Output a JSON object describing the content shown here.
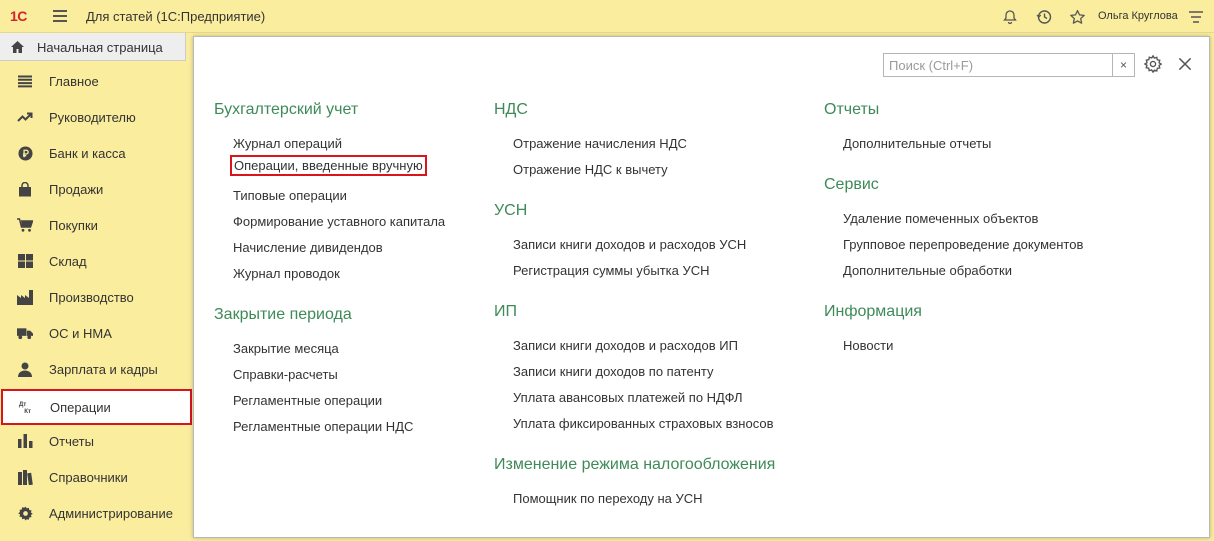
{
  "titlebar": {
    "logo": "1С",
    "title": "Для статей  (1С:Предприятие)",
    "user": "Ольга Круглова",
    "icons": [
      "bell-icon",
      "history-icon",
      "star-icon",
      "menu-lines-icon"
    ]
  },
  "home_tab": {
    "label": "Начальная страница",
    "icon": "home-icon"
  },
  "sidebar": {
    "items": [
      {
        "label": "Главное",
        "icon": "list-icon"
      },
      {
        "label": "Руководителю",
        "icon": "trend-icon"
      },
      {
        "label": "Банк и касса",
        "icon": "ruble-icon"
      },
      {
        "label": "Продажи",
        "icon": "bag-icon"
      },
      {
        "label": "Покупки",
        "icon": "cart-icon"
      },
      {
        "label": "Склад",
        "icon": "grid-icon"
      },
      {
        "label": "Производство",
        "icon": "factory-icon"
      },
      {
        "label": "ОС и НМА",
        "icon": "truck-icon"
      },
      {
        "label": "Зарплата и кадры",
        "icon": "person-icon"
      },
      {
        "label": "Операции",
        "icon": "dt-kt-icon",
        "active": true
      },
      {
        "label": "Отчеты",
        "icon": "bar-chart-icon"
      },
      {
        "label": "Справочники",
        "icon": "books-icon"
      },
      {
        "label": "Администрирование",
        "icon": "gear-icon"
      }
    ]
  },
  "panel": {
    "search_placeholder": "Поиск (Ctrl+F)",
    "search_clear": "×",
    "sections": {
      "accounting": {
        "title": "Бухгалтерский учет",
        "links": [
          "Журнал операций",
          "Операции, введенные вручную",
          "Типовые операции",
          "Формирование уставного капитала",
          "Начисление дивидендов",
          "Журнал проводок"
        ]
      },
      "closing": {
        "title": "Закрытие периода",
        "links": [
          "Закрытие месяца",
          "Справки-расчеты",
          "Регламентные операции",
          "Регламентные операции НДС"
        ]
      },
      "vat": {
        "title": "НДС",
        "links": [
          "Отражение начисления НДС",
          "Отражение НДС к вычету"
        ]
      },
      "usn": {
        "title": "УСН",
        "links": [
          "Записи книги доходов и расходов УСН",
          "Регистрация суммы убытка УСН"
        ]
      },
      "ip": {
        "title": "ИП",
        "links": [
          "Записи книги доходов и расходов ИП",
          "Записи книги доходов по патенту",
          "Уплата авансовых платежей по НДФЛ",
          "Уплата фиксированных страховых взносов"
        ]
      },
      "tax_change": {
        "title": "Изменение режима налогообложения",
        "links": [
          "Помощник по переходу на УСН"
        ]
      },
      "reports": {
        "title": "Отчеты",
        "links": [
          "Дополнительные отчеты"
        ]
      },
      "service": {
        "title": "Сервис",
        "links": [
          "Удаление помеченных объектов",
          "Групповое перепроведение документов",
          "Дополнительные обработки"
        ]
      },
      "info": {
        "title": "Информация",
        "links": [
          "Новости"
        ]
      }
    }
  },
  "colors": {
    "background": "#fbed9e",
    "section_title": "#3e8a58",
    "highlight": "#d9141b",
    "logo": "#d4232b"
  }
}
